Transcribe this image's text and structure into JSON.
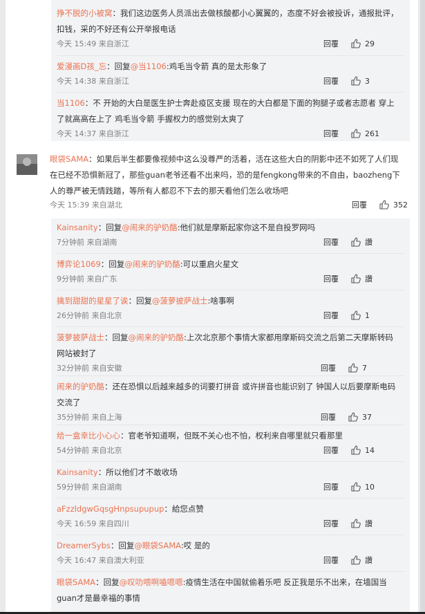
{
  "top_replies": [
    {
      "name": "挣不脱的小被窝",
      "text": "：我们这边医务人员派出去做核酸都小心翼翼的，态度不好会被投诉，通报批评，扣钱，采的不好还有公开举报电话",
      "time": "今天 15:49",
      "loc": "来自浙江",
      "reply": "回覆",
      "likes": "29"
    },
    {
      "name": "爱漫画D孩_忘",
      "text": "：回复",
      "at": "@当1106",
      "tail": ":鸡毛当令箭 真的是太形象了",
      "time": "今天 14:38",
      "loc": "来自浙江",
      "reply": "回覆",
      "likes": "3"
    },
    {
      "name": "当1106",
      "text": "：不 开始的大白是医生护士奔赴疫区支援 现在的大白都是下面的狗腿子或者志愿者 穿上了就高高在上了 鸡毛当令箭 手握权力的感觉别太爽了",
      "time": "今天 14:37",
      "loc": "来自浙江",
      "reply": "回覆",
      "likes": "261"
    }
  ],
  "main_comment": {
    "name": "眼袋SAMA",
    "text": "：如果后半生都要像视频中这么没尊严的活着，活在这些大白的阴影中还不如死了人们现在已经不恐惧新冠了，那些guan老爷还看不出来吗，恐的是fengkong带来的不自由，baozheng下人的尊严被无情践踏，等所有人都忍不下去的那天看他们怎么收场吧",
    "time": "今天 15:39",
    "loc": "来自湖北",
    "reply": "回覆",
    "likes": "352"
  },
  "replies": [
    {
      "name": "Kainsanity",
      "pre": "：回复",
      "at": "@闹来的驴奶酪",
      "tail": ":他们就是摩斯起家你这不是自投罗网吗",
      "time": "7分钟前",
      "loc": "来自湖南",
      "reply": "回覆",
      "likes": "讚"
    },
    {
      "name": "博弈论1069",
      "pre": "：回复",
      "at": "@闹来的驴奶酪",
      "tail": ":可以重启火星文",
      "time": "9分钟前",
      "loc": "来自广东",
      "reply": "回覆",
      "likes": "讚"
    },
    {
      "name": "擒到甜甜的星星了诶",
      "pre": "：回复",
      "at": "@菠萝披萨战士",
      "tail": ":啥事啊",
      "time": "26分钟前",
      "loc": "来自北京",
      "reply": "回覆",
      "likes": "1"
    },
    {
      "name": "菠萝披萨战士",
      "pre": "：回复",
      "at": "@闹来的驴奶酪",
      "tail": ":上次北京那个事情大家都用摩斯码交流之后第二天摩斯转码网站被封了",
      "time": "32分钟前",
      "loc": "来自安徽",
      "reply": "回覆",
      "likes": "7"
    },
    {
      "name": "闹来的驴奶酪",
      "pre": "：还在恐惧以后越来越多的词要打拼音 或许拼音也能识别了 钟国人以后要摩斯电码交流了",
      "at": "",
      "tail": "",
      "time": "35分钟前",
      "loc": "来自上海",
      "reply": "回覆",
      "likes": "37"
    },
    {
      "name": "给一盒幸比小心心",
      "pre": "：官老爷知道啊，但既不关心也不怕，权利来自哪里就只看那里",
      "at": "",
      "tail": "",
      "time": "54分钟前",
      "loc": "来自北京",
      "reply": "回覆",
      "likes": "14"
    },
    {
      "name": "Kainsanity",
      "pre": "：所以他们才不敢收场",
      "at": "",
      "tail": "",
      "time": "59分钟前",
      "loc": "来自湖南",
      "reply": "回覆",
      "likes": "10"
    },
    {
      "name": "aFzzldgwGqsgHnpsupupup",
      "pre": "：給您点赞",
      "at": "",
      "tail": "",
      "time": "今天 16:59",
      "loc": "来自四川",
      "reply": "回覆",
      "likes": "讚"
    },
    {
      "name": "DreamerSybs",
      "pre": "：回复",
      "at": "@眼袋SAMA",
      "tail": ":哎 是的",
      "time": "今天 16:47",
      "loc": "来自澳大利亚",
      "reply": "回覆",
      "likes": "讚"
    },
    {
      "name": "眼袋SAMA",
      "pre": "：回复",
      "at": "@叹叻喂啊嗑嗯嗯",
      "tail": ":疫情生活在中国就偷着乐吧 反正我是乐不出来，在墙国当guan才是最幸福的事情",
      "time": "",
      "loc": "",
      "reply": "",
      "likes": ""
    }
  ]
}
